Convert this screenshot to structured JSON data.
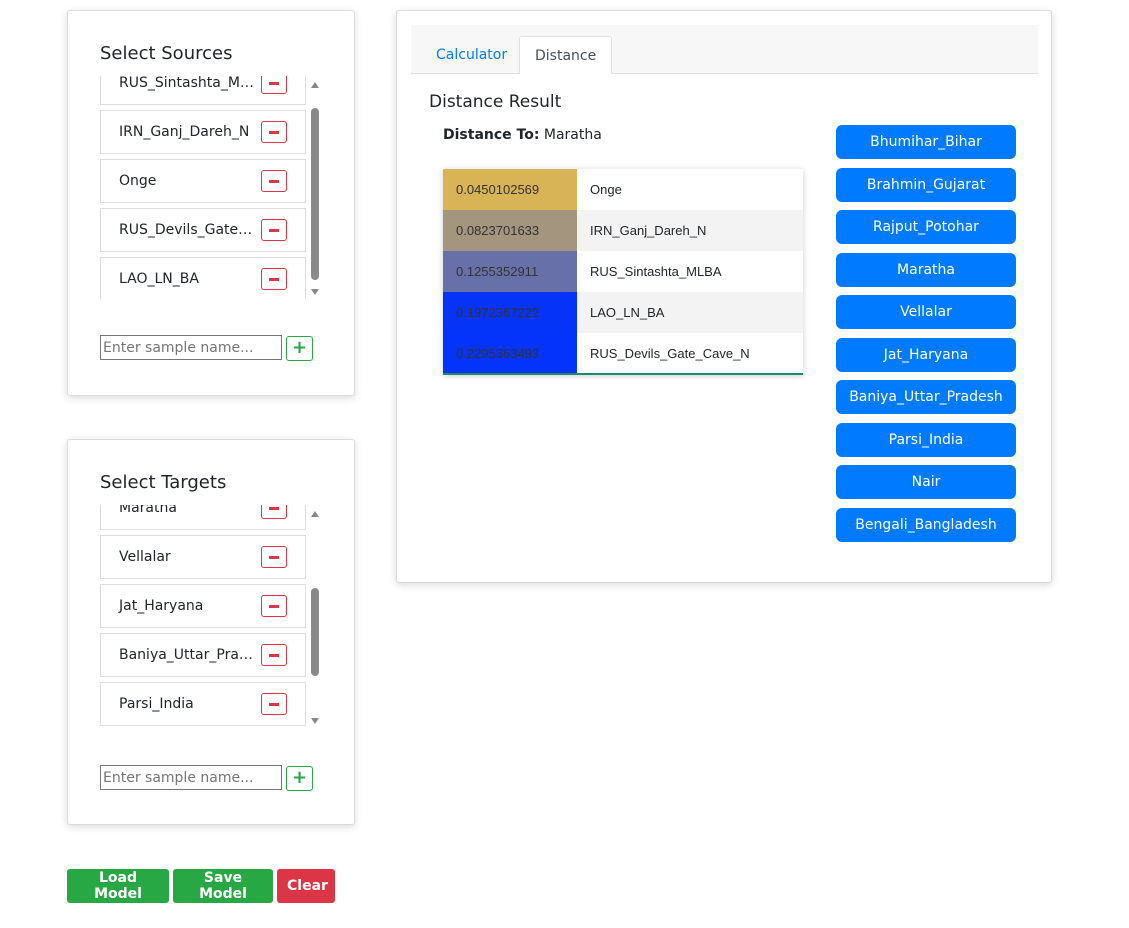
{
  "sources": {
    "title": "Select Sources",
    "items": [
      "RUS_Sintashta_MLBA",
      "IRN_Ganj_Dareh_N",
      "Onge",
      "RUS_Devils_Gate_Cave_N",
      "LAO_LN_BA"
    ],
    "placeholder": "Enter sample name..."
  },
  "targets": {
    "title": "Select Targets",
    "items": [
      "Maratha",
      "Vellalar",
      "Jat_Haryana",
      "Baniya_Uttar_Pradesh",
      "Parsi_India"
    ],
    "placeholder": "Enter sample name..."
  },
  "actions": {
    "load": "Load Model",
    "save": "Save Model",
    "clear": "Clear"
  },
  "tabs": [
    {
      "label": "Calculator"
    },
    {
      "label": "Distance"
    }
  ],
  "result": {
    "title": "Distance Result",
    "distance_to_label": "Distance To:",
    "distance_to": "Maratha",
    "rows": [
      {
        "value": "0.0450102569",
        "name": "Onge",
        "color": "#d8b456"
      },
      {
        "value": "0.0823701633",
        "name": "IRN_Ganj_Dareh_N",
        "color": "#a3957e"
      },
      {
        "value": "0.1255352911",
        "name": "RUS_Sintashta_MLBA",
        "color": "#6870aa"
      },
      {
        "value": "0.1972367222",
        "name": "LAO_LN_BA",
        "color": "#0534f8"
      },
      {
        "value": "0.2295363493",
        "name": "RUS_Devils_Gate_Cave_N",
        "color": "#0433fb"
      }
    ]
  },
  "target_buttons": [
    "Bhumihar_Bihar",
    "Brahmin_Gujarat",
    "Rajput_Potohar",
    "Maratha",
    "Vellalar",
    "Jat_Haryana",
    "Baniya_Uttar_Pradesh",
    "Parsi_India",
    "Nair",
    "Bengali_Bangladesh"
  ],
  "colors": {
    "primary": "#007bff",
    "success": "#28a745",
    "danger": "#dc3545"
  }
}
